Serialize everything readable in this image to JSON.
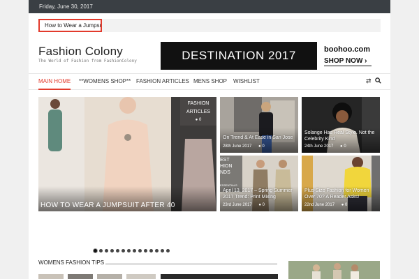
{
  "topbar": {
    "date": "Friday, June 30, 2017"
  },
  "ticker": {
    "headline": "How to Wear a Jumpsuit"
  },
  "site": {
    "title": "Fashion Colony",
    "tagline": "The World of Fashion from FashionColony"
  },
  "banner": {
    "headline": "DESTINATION 2017",
    "brand": "boohoo.com",
    "cta": "SHOP NOW ›"
  },
  "nav": {
    "items": [
      "MAIN HOME",
      "**WOMENS SHOP**",
      "FASHION ARTICLES",
      "MENS SHOP",
      "WISHLIST"
    ],
    "icons": [
      "shuffle-icon",
      "search-icon"
    ]
  },
  "featured": {
    "main_title": "HOW TO WEAR A JUMPSUIT AFTER 40",
    "category": "FASHION ARTICLES",
    "comments": "0"
  },
  "grid": [
    {
      "title": "On Trend & At Ease in San Jose",
      "date": "28th June 2017",
      "comments": "0"
    },
    {
      "title": "Solange Has Real Style. Not the Celebrity Kind",
      "date": "24th June 2017",
      "comments": "0"
    },
    {
      "title": "April 13, 2017 – Spring Summer 2017 Trend: Print Mixing",
      "date": "23rd June 2017",
      "comments": "0",
      "overlay": "EST\nHION\nNDS",
      "badge": "ESSENTIALS"
    },
    {
      "title": "Plus-Size Fashion for Women Over 70? A Reader Asks!",
      "date": "22nd June 2017",
      "comments": "0"
    }
  ],
  "slider": {
    "count": 14,
    "active": 0
  },
  "section": {
    "title": "WOMENS FASHION TIPS"
  },
  "colors": {
    "accent": "#e23a2c",
    "topbar": "#3a3f44"
  }
}
